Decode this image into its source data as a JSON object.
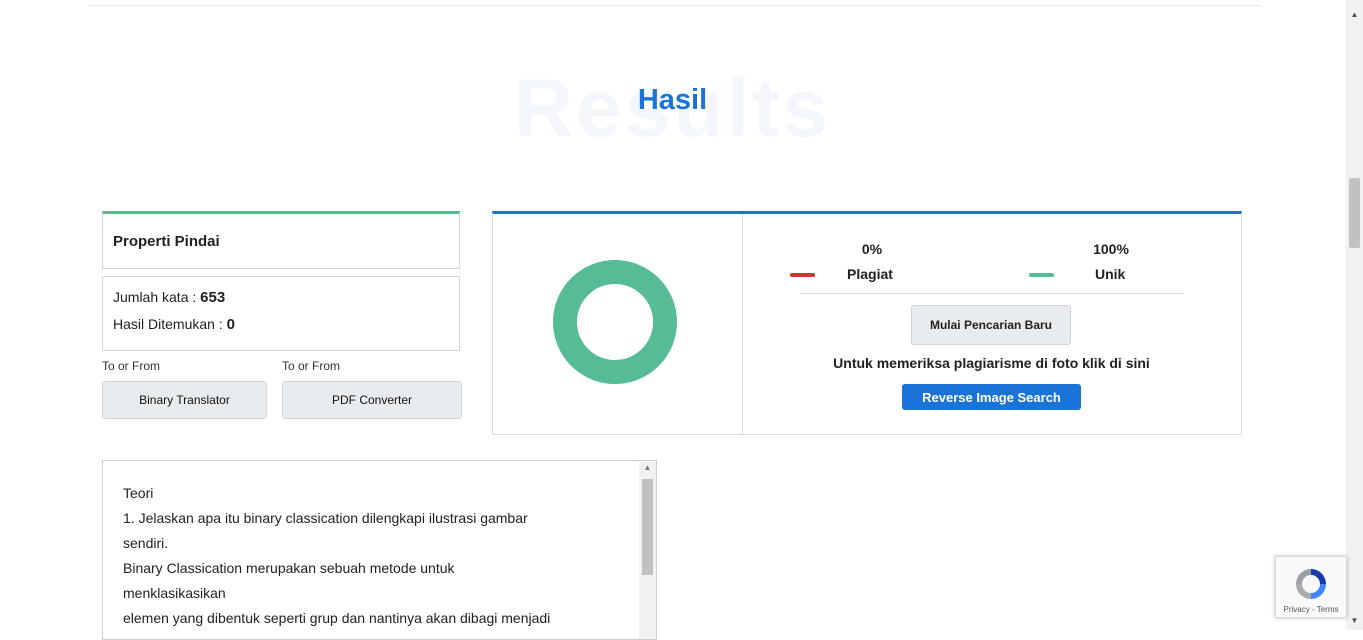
{
  "header": {
    "background_word": "Results",
    "title": "Hasil"
  },
  "scan_properties": {
    "title": "Properti Pindai",
    "word_count_label": "Jumlah kata :",
    "word_count_value": "653",
    "found_label": "Hasil Ditemukan :",
    "found_value": "0"
  },
  "tools": [
    {
      "label": "To or From",
      "button": "Binary Translator"
    },
    {
      "label": "To or From",
      "button": "PDF Converter"
    }
  ],
  "result": {
    "plagiarism_percent": "0%",
    "plagiarism_label": "Plagiat",
    "plagiarism_color": "#d63031",
    "unique_percent": "100%",
    "unique_label": "Unik",
    "unique_color": "#56bc96",
    "unique_fraction": 1.0,
    "new_search_label": "Mulai Pencarian Baru",
    "image_check_text": "Untuk memeriksa plagiarisme di foto klik di sini",
    "reverse_image_label": "Reverse Image Search"
  },
  "text_input": {
    "lines": [
      "Teori",
      "1. Jelaskan apa itu binary classication dilengkapi ilustrasi gambar",
      "sendiri.",
      "Binary Classication merupakan sebuah metode untuk",
      "menklasikasikan",
      "elemen yang dibentuk seperti grup dan nantinya akan dibagi menjadi"
    ]
  },
  "recaptcha": {
    "privacy": "Privacy",
    "separator": " - ",
    "terms": "Terms"
  },
  "colors": {
    "accent_blue": "#1a73d9",
    "accent_green": "#4cbf84"
  }
}
